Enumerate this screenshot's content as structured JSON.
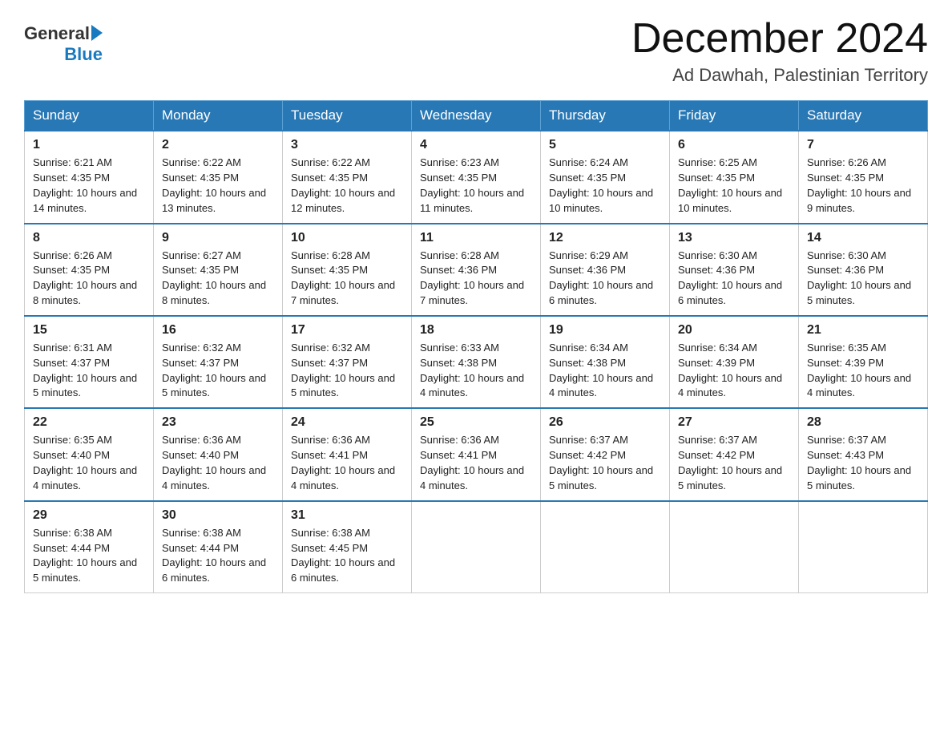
{
  "logo": {
    "text_general": "General",
    "text_blue": "Blue",
    "arrow": true
  },
  "title": "December 2024",
  "subtitle": "Ad Dawhah, Palestinian Territory",
  "days_of_week": [
    "Sunday",
    "Monday",
    "Tuesday",
    "Wednesday",
    "Thursday",
    "Friday",
    "Saturday"
  ],
  "weeks": [
    [
      {
        "day": "1",
        "sunrise": "6:21 AM",
        "sunset": "4:35 PM",
        "daylight": "10 hours and 14 minutes."
      },
      {
        "day": "2",
        "sunrise": "6:22 AM",
        "sunset": "4:35 PM",
        "daylight": "10 hours and 13 minutes."
      },
      {
        "day": "3",
        "sunrise": "6:22 AM",
        "sunset": "4:35 PM",
        "daylight": "10 hours and 12 minutes."
      },
      {
        "day": "4",
        "sunrise": "6:23 AM",
        "sunset": "4:35 PM",
        "daylight": "10 hours and 11 minutes."
      },
      {
        "day": "5",
        "sunrise": "6:24 AM",
        "sunset": "4:35 PM",
        "daylight": "10 hours and 10 minutes."
      },
      {
        "day": "6",
        "sunrise": "6:25 AM",
        "sunset": "4:35 PM",
        "daylight": "10 hours and 10 minutes."
      },
      {
        "day": "7",
        "sunrise": "6:26 AM",
        "sunset": "4:35 PM",
        "daylight": "10 hours and 9 minutes."
      }
    ],
    [
      {
        "day": "8",
        "sunrise": "6:26 AM",
        "sunset": "4:35 PM",
        "daylight": "10 hours and 8 minutes."
      },
      {
        "day": "9",
        "sunrise": "6:27 AM",
        "sunset": "4:35 PM",
        "daylight": "10 hours and 8 minutes."
      },
      {
        "day": "10",
        "sunrise": "6:28 AM",
        "sunset": "4:35 PM",
        "daylight": "10 hours and 7 minutes."
      },
      {
        "day": "11",
        "sunrise": "6:28 AM",
        "sunset": "4:36 PM",
        "daylight": "10 hours and 7 minutes."
      },
      {
        "day": "12",
        "sunrise": "6:29 AM",
        "sunset": "4:36 PM",
        "daylight": "10 hours and 6 minutes."
      },
      {
        "day": "13",
        "sunrise": "6:30 AM",
        "sunset": "4:36 PM",
        "daylight": "10 hours and 6 minutes."
      },
      {
        "day": "14",
        "sunrise": "6:30 AM",
        "sunset": "4:36 PM",
        "daylight": "10 hours and 5 minutes."
      }
    ],
    [
      {
        "day": "15",
        "sunrise": "6:31 AM",
        "sunset": "4:37 PM",
        "daylight": "10 hours and 5 minutes."
      },
      {
        "day": "16",
        "sunrise": "6:32 AM",
        "sunset": "4:37 PM",
        "daylight": "10 hours and 5 minutes."
      },
      {
        "day": "17",
        "sunrise": "6:32 AM",
        "sunset": "4:37 PM",
        "daylight": "10 hours and 5 minutes."
      },
      {
        "day": "18",
        "sunrise": "6:33 AM",
        "sunset": "4:38 PM",
        "daylight": "10 hours and 4 minutes."
      },
      {
        "day": "19",
        "sunrise": "6:34 AM",
        "sunset": "4:38 PM",
        "daylight": "10 hours and 4 minutes."
      },
      {
        "day": "20",
        "sunrise": "6:34 AM",
        "sunset": "4:39 PM",
        "daylight": "10 hours and 4 minutes."
      },
      {
        "day": "21",
        "sunrise": "6:35 AM",
        "sunset": "4:39 PM",
        "daylight": "10 hours and 4 minutes."
      }
    ],
    [
      {
        "day": "22",
        "sunrise": "6:35 AM",
        "sunset": "4:40 PM",
        "daylight": "10 hours and 4 minutes."
      },
      {
        "day": "23",
        "sunrise": "6:36 AM",
        "sunset": "4:40 PM",
        "daylight": "10 hours and 4 minutes."
      },
      {
        "day": "24",
        "sunrise": "6:36 AM",
        "sunset": "4:41 PM",
        "daylight": "10 hours and 4 minutes."
      },
      {
        "day": "25",
        "sunrise": "6:36 AM",
        "sunset": "4:41 PM",
        "daylight": "10 hours and 4 minutes."
      },
      {
        "day": "26",
        "sunrise": "6:37 AM",
        "sunset": "4:42 PM",
        "daylight": "10 hours and 5 minutes."
      },
      {
        "day": "27",
        "sunrise": "6:37 AM",
        "sunset": "4:42 PM",
        "daylight": "10 hours and 5 minutes."
      },
      {
        "day": "28",
        "sunrise": "6:37 AM",
        "sunset": "4:43 PM",
        "daylight": "10 hours and 5 minutes."
      }
    ],
    [
      {
        "day": "29",
        "sunrise": "6:38 AM",
        "sunset": "4:44 PM",
        "daylight": "10 hours and 5 minutes."
      },
      {
        "day": "30",
        "sunrise": "6:38 AM",
        "sunset": "4:44 PM",
        "daylight": "10 hours and 6 minutes."
      },
      {
        "day": "31",
        "sunrise": "6:38 AM",
        "sunset": "4:45 PM",
        "daylight": "10 hours and 6 minutes."
      },
      null,
      null,
      null,
      null
    ]
  ]
}
